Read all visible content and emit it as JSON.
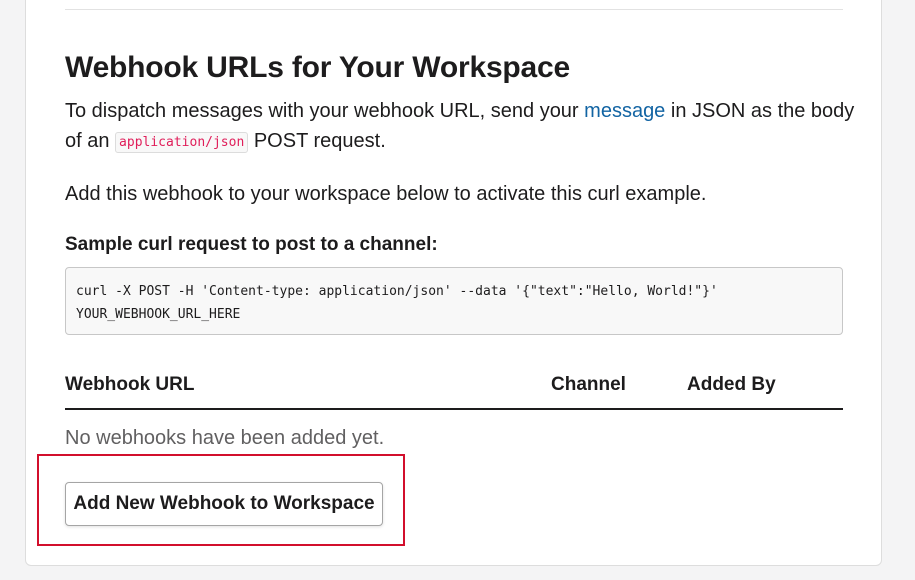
{
  "section": {
    "title": "Webhook URLs for Your Workspace",
    "intro": {
      "part1": "To dispatch messages with your webhook URL, send your ",
      "link_text": "message",
      "part2": " in JSON as the body of an ",
      "code": "application/json",
      "part3": " POST request."
    },
    "activate_text": "Add this webhook to your workspace below to activate this curl example.",
    "sample_label": "Sample curl request to post to a channel:",
    "curl_line1": "curl -X POST -H 'Content-type: application/json' --data '{\"text\":\"Hello, World!\"}'",
    "curl_line2": "YOUR_WEBHOOK_URL_HERE"
  },
  "table": {
    "headers": [
      "Webhook URL",
      "Channel",
      "Added By"
    ],
    "empty_message": "No webhooks have been added yet."
  },
  "add_button_label": "Add New Webhook to Workspace",
  "colors": {
    "link": "#1264a3",
    "inline_code": "#e01e5a",
    "highlight": "#d20f2c"
  }
}
